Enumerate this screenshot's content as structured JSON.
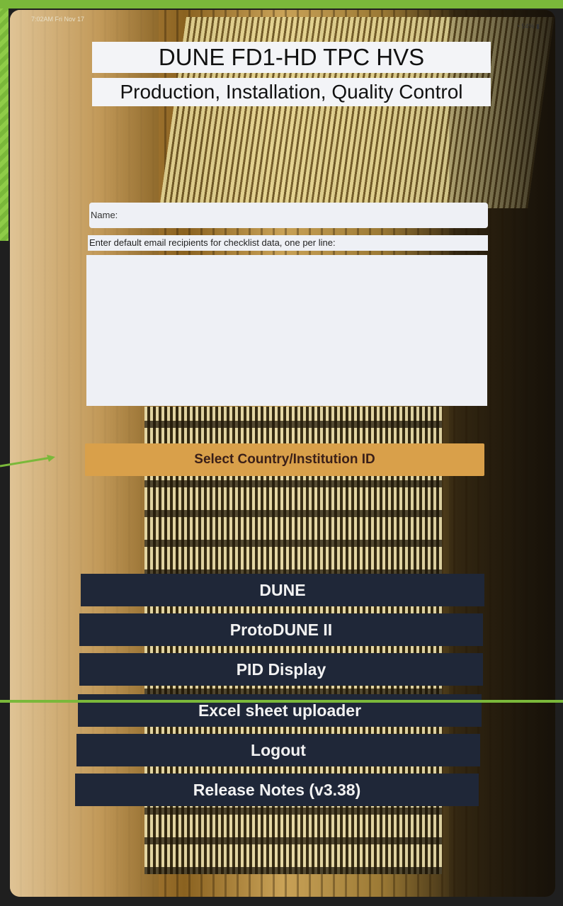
{
  "status_bar": {
    "time": "7:02AM  Fri Nov 17",
    "battery": "54%"
  },
  "header": {
    "title": "DUNE FD1-HD TPC HVS",
    "subtitle": "Production, Installation, Quality Control"
  },
  "form": {
    "name_label": "Name:",
    "name_value": "",
    "email_label": "Enter default email recipients for checklist data, one per line:",
    "email_value": ""
  },
  "select_button": {
    "label": "Select Country/Institution ID",
    "color": "#d9a04a"
  },
  "menu": {
    "color": "#1f2738",
    "items": [
      {
        "label": "DUNE"
      },
      {
        "label": "ProtoDUNE II"
      },
      {
        "label": "PID Display"
      },
      {
        "label": "Excel sheet uploader"
      },
      {
        "label": "Logout"
      },
      {
        "label": "Release Notes (v3.38)"
      }
    ]
  },
  "accent": "#7ab83a"
}
